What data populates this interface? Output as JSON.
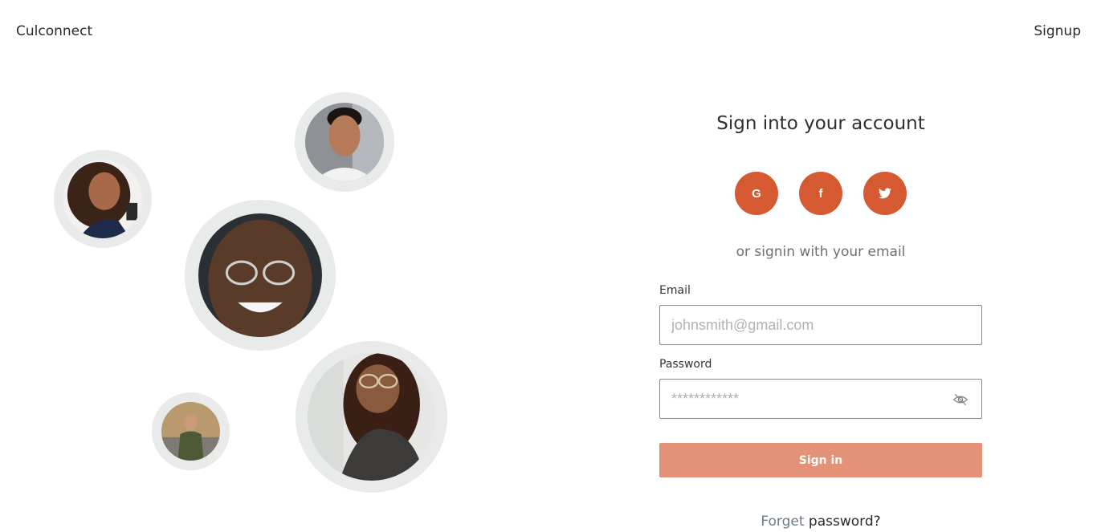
{
  "header": {
    "brand": "Culconnect",
    "signup_label": "Signup"
  },
  "avatars": [
    {
      "name": "woman-curly-hair"
    },
    {
      "name": "man-smiling"
    },
    {
      "name": "man-glasses"
    },
    {
      "name": "man-street"
    },
    {
      "name": "woman-glasses"
    }
  ],
  "form": {
    "title": "Sign into your account",
    "social": [
      {
        "label": "G",
        "icon": "google-icon"
      },
      {
        "label": "f",
        "icon": "facebook-icon"
      },
      {
        "label": "twitter",
        "icon": "twitter-icon"
      }
    ],
    "or_text": "or signin with your email",
    "email": {
      "label": "Email",
      "placeholder": "johnsmith@gmail.com"
    },
    "password": {
      "label": "Password",
      "placeholder": "************",
      "toggle_icon": "eye-slash-icon"
    },
    "signin_label": "Sign in",
    "forget_prefix": "Forget",
    "forget_suffix": "password?"
  },
  "colors": {
    "accent": "#d65a31",
    "signin_button": "#e39177",
    "avatar_ring": "#e9eaea"
  }
}
